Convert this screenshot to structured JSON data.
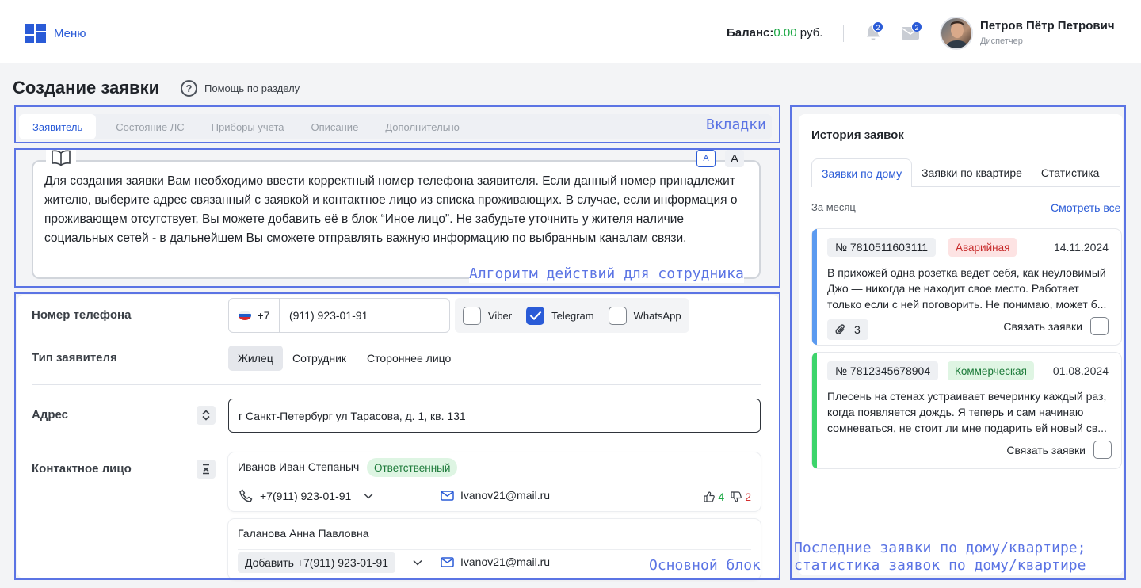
{
  "header": {
    "menu_label": "Меню",
    "balance_label": "Баланс:",
    "balance_value": "0.00",
    "balance_currency": "руб.",
    "notifications_count": "2",
    "messages_count": "2",
    "user_name": "Петров Пётр Петрович",
    "user_role": "Диспетчер"
  },
  "page": {
    "title": "Создание заявки",
    "help_label": "Помощь по разделу"
  },
  "tabs": [
    {
      "label": "Заявитель"
    },
    {
      "label": "Состояние ЛС"
    },
    {
      "label": "Приборы учета"
    },
    {
      "label": "Описание"
    },
    {
      "label": "Дополнительно"
    }
  ],
  "algorithm": {
    "text": "Для создания заявки Вам необходимо ввести корректный номер телефона заявителя. Если данный номер принадлежит жителю, выберите адрес связанный с заявкой и контактное лицо из списка проживающих. В случае, если информация о проживающем отсутствует, Вы можете добавить её в блок “Иное лицо”. Не забудьте уточнить у жителя наличие социальных сетей - в дальнейшем Вы сможете отправлять важную информацию по выбранным каналам связи.",
    "font_small_label": "A",
    "font_large_label": "A"
  },
  "form": {
    "phone_label": "Номер телефона",
    "phone_code": "+7",
    "phone_value": "(911) 923-01-91",
    "messengers": [
      {
        "label": "Viber",
        "checked": false
      },
      {
        "label": "Telegram",
        "checked": true
      },
      {
        "label": "WhatsApp",
        "checked": false
      }
    ],
    "applicant_type_label": "Тип заявителя",
    "applicant_types": [
      {
        "label": "Жилец",
        "active": true
      },
      {
        "label": "Сотрудник",
        "active": false
      },
      {
        "label": "Стороннее лицо",
        "active": false
      }
    ],
    "address_label": "Адрес",
    "address_value": "г Санкт-Петербург ул Тарасова, д. 1, кв. 131",
    "contact_label": "Контактное лицо",
    "contacts": [
      {
        "name": "Иванов Иван Степаныч",
        "tag": "Ответственный",
        "phone": "+7(911) 923-01-91",
        "email": "Ivanov21@mail.ru",
        "likes": "4",
        "dislikes": "2"
      },
      {
        "name": "Галанова Анна Павловна",
        "add_phone_label": "Добавить +7(911) 923-01-91",
        "email": "Ivanov21@mail.ru"
      }
    ]
  },
  "history": {
    "title": "История заявок",
    "tabs": [
      {
        "label": "Заявки по дому",
        "active": true
      },
      {
        "label": "Заявки по квартире",
        "active": false
      },
      {
        "label": "Статистика",
        "active": false
      }
    ],
    "period_label": "За месяц",
    "see_all_label": "Смотреть все",
    "link_label": "Связать заявки",
    "requests": [
      {
        "number": "№ 7810511603111",
        "tag": "Аварийная",
        "tag_color": "#fde3e3",
        "tag_text_color": "#c62828",
        "bar_color": "#5b9af0",
        "date": "14.11.2024",
        "text": "В прихожей одна розетка ведет себя, как неуловимый Джо — никогда не находит свое место. Работает только если с ней поговорить. Не понимаю, может б...",
        "attachments": "3"
      },
      {
        "number": "№ 7812345678904",
        "tag": "Коммерческая",
        "tag_color": "#dff5e3",
        "tag_text_color": "#1c7a39",
        "bar_color": "#3dd46b",
        "date": "01.08.2024",
        "text": "Плесень на стенах устраивает вечеринку каждый раз, когда появляется дождь. Я теперь и сам начинаю сомневаться, не стоит ли мне подарить ей новый св..."
      }
    ]
  },
  "annotations": {
    "tabs_label": "Вкладки",
    "algorithm_label": "Алгоритм действий для сотрудника",
    "main_label": "Основной блок",
    "history_label_1": "Последние заявки по дому/квартире;",
    "history_label_2": "статистика заявок по дому/квартире"
  },
  "colors": {
    "accent": "#2a5bd7",
    "annotation": "#5b74e4",
    "balance": "#1aa843"
  }
}
